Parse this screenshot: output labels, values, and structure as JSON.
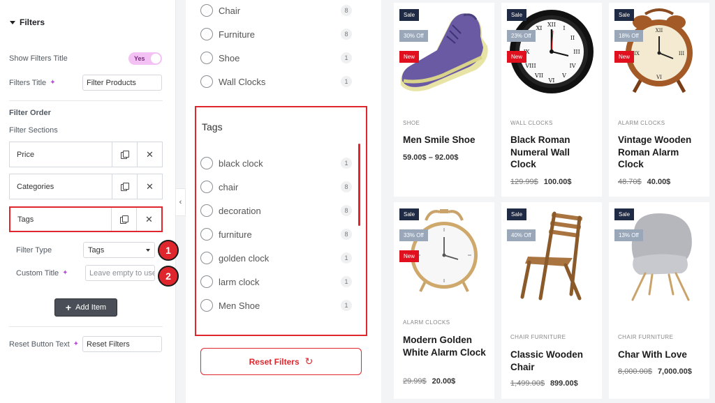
{
  "left_panel": {
    "section_title": "Filters",
    "show_title": {
      "label": "Show Filters Title",
      "toggle": "Yes"
    },
    "filters_title": {
      "label": "Filters Title",
      "value": "Filter Products"
    },
    "filter_order_heading": "Filter Order",
    "filter_sections_label": "Filter Sections",
    "sections": [
      {
        "title": "Price"
      },
      {
        "title": "Categories"
      },
      {
        "title": "Tags"
      }
    ],
    "filter_type": {
      "label": "Filter Type",
      "value": "Tags"
    },
    "custom_title": {
      "label": "Custom Title",
      "placeholder": "Leave empty to use default"
    },
    "add_item": "Add Item",
    "reset_button_text": {
      "label": "Reset Button Text",
      "value": "Reset Filters"
    },
    "markers": [
      "1",
      "2"
    ],
    "collapse_icon": "‹"
  },
  "categories": [
    {
      "label": "Chair",
      "count": "8"
    },
    {
      "label": "Furniture",
      "count": "8"
    },
    {
      "label": "Shoe",
      "count": "1"
    },
    {
      "label": "Wall Clocks",
      "count": "1"
    }
  ],
  "tags_section": {
    "title": "Tags",
    "items": [
      {
        "label": "black clock",
        "count": "1"
      },
      {
        "label": "chair",
        "count": "8"
      },
      {
        "label": "decoration",
        "count": "8"
      },
      {
        "label": "furniture",
        "count": "8"
      },
      {
        "label": "golden clock",
        "count": "1"
      },
      {
        "label": "larm clock",
        "count": "1"
      },
      {
        "label": "Men Shoe",
        "count": "1"
      }
    ]
  },
  "reset_button": "Reset Filters",
  "products": [
    {
      "sale": "Sale",
      "off": "30% Off",
      "new": "New",
      "category": "SHOE",
      "name": "Men Smile Shoe",
      "price_range": "59.00$ – 92.00$"
    },
    {
      "sale": "Sale",
      "off": "23% Off",
      "new": "New",
      "category": "WALL CLOCKS",
      "name": "Black Roman Numeral Wall Clock",
      "old_price": "129.99$",
      "price": "100.00$"
    },
    {
      "sale": "Sale",
      "off": "18% Off",
      "new": "New",
      "category": "ALARM CLOCKS",
      "name": "Vintage Wooden Roman Alarm Clock",
      "old_price": "48.70$",
      "price": "40.00$"
    },
    {
      "sale": "Sale",
      "off": "33% Off",
      "new": "New",
      "category": "ALARM CLOCKS",
      "name": "Modern Golden White Alarm Clock",
      "old_price": "29.99$",
      "price": "20.00$"
    },
    {
      "sale": "Sale",
      "off": "40% Off",
      "category": "CHAIR   FURNITURE",
      "name": "Classic Wooden Chair",
      "old_price": "1,499.00$",
      "price": "899.00$"
    },
    {
      "sale": "Sale",
      "off": "13% Off",
      "category": "CHAIR   FURNITURE",
      "name": "Char With Love",
      "old_price": "8,000.00$",
      "price": "7,000.00$"
    }
  ],
  "colors": {
    "accent_red": "#e0262d",
    "sale_badge": "#1f2a44",
    "off_badge": "#9aa7b8",
    "new_badge": "#e0101f",
    "toggle_bg": "#f3c1f3"
  }
}
